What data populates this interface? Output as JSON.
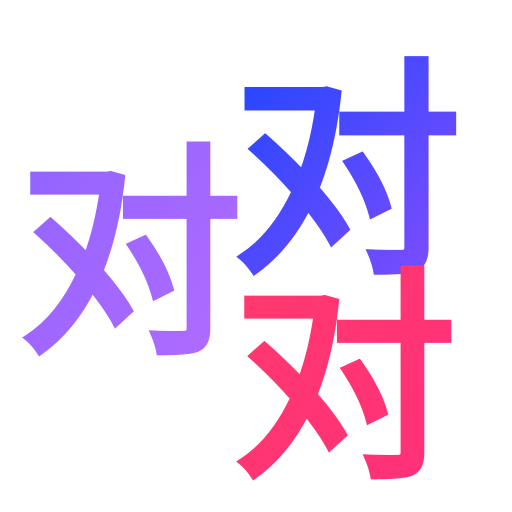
{
  "glyph": "对",
  "colors": {
    "purple_start": "#8f63ff",
    "purple_end": "#b46cff",
    "blue_start": "#1c46ff",
    "blue_end": "#8a4dff",
    "pink_start": "#ff3a6e",
    "pink_end": "#ff2f7a"
  }
}
